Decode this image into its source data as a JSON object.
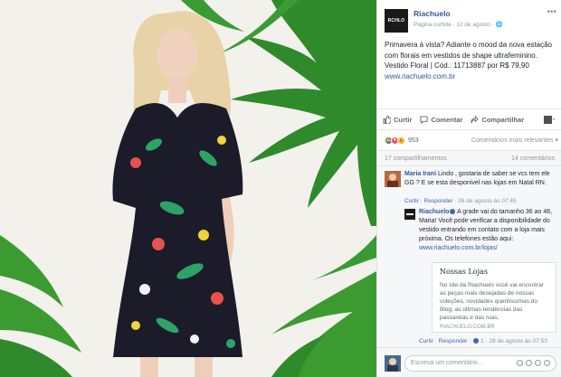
{
  "post": {
    "page_name": "Riachuelo",
    "logo_text": "RCHLO",
    "subtitle": "Página curtida · 12 de agosto · 🌐",
    "more_icon": "ellipsis-icon",
    "message": "Primavera à vista? Adiante o mood da nova estação com florais em vestidos de shape ultrafeminino. Vestido Floral | Cód.: 11713887 por R$ 79,90",
    "link": "www.riachuelo.com.br"
  },
  "actions": {
    "like": "Curtir",
    "comment": "Comentar",
    "share": "Compartilhar"
  },
  "reactions": {
    "count": "953",
    "sort": "Comentários mais relevantes ▾",
    "colors": {
      "like": "#4267b2",
      "love": "#f25268",
      "haha": "#f7b125"
    }
  },
  "stats": {
    "shares": "17 compartilhamentos",
    "comments": "14 comentários"
  },
  "comments": [
    {
      "author": "Maria Irani",
      "text": "Lindo , gostaria de saber se vcs tem ele GG ? E se esta desponivel nas lojas em Natal RN.",
      "like": "Curtir",
      "reply": "Responder",
      "time": "26 de agosto às 07:45"
    },
    {
      "author": "Riachuelo",
      "text": "A grade vai do tamanho 36 ao 46, Maria! Você pode verificar a disponibilidade do vestido entrando em contato com a loja mais próxima. Os telefones estão aqui:",
      "link": "www.riachuelo.com.br/lojas/",
      "like": "Curtir",
      "reply": "Responder",
      "reaction_count": "1",
      "time": "28 de agosto às 07:53"
    }
  ],
  "link_card": {
    "title": "Nossas Lojas",
    "description": "No site da Riachuelo você vai encontrar as peças mais desejadas de nossas coleções, novidades quentíssimas do Blog, as últimas tendências das passarelas e das ruas,",
    "domain": "RIACHUELO.COM.BR"
  },
  "write_comment": {
    "placeholder": "Escreva um comentário..."
  }
}
